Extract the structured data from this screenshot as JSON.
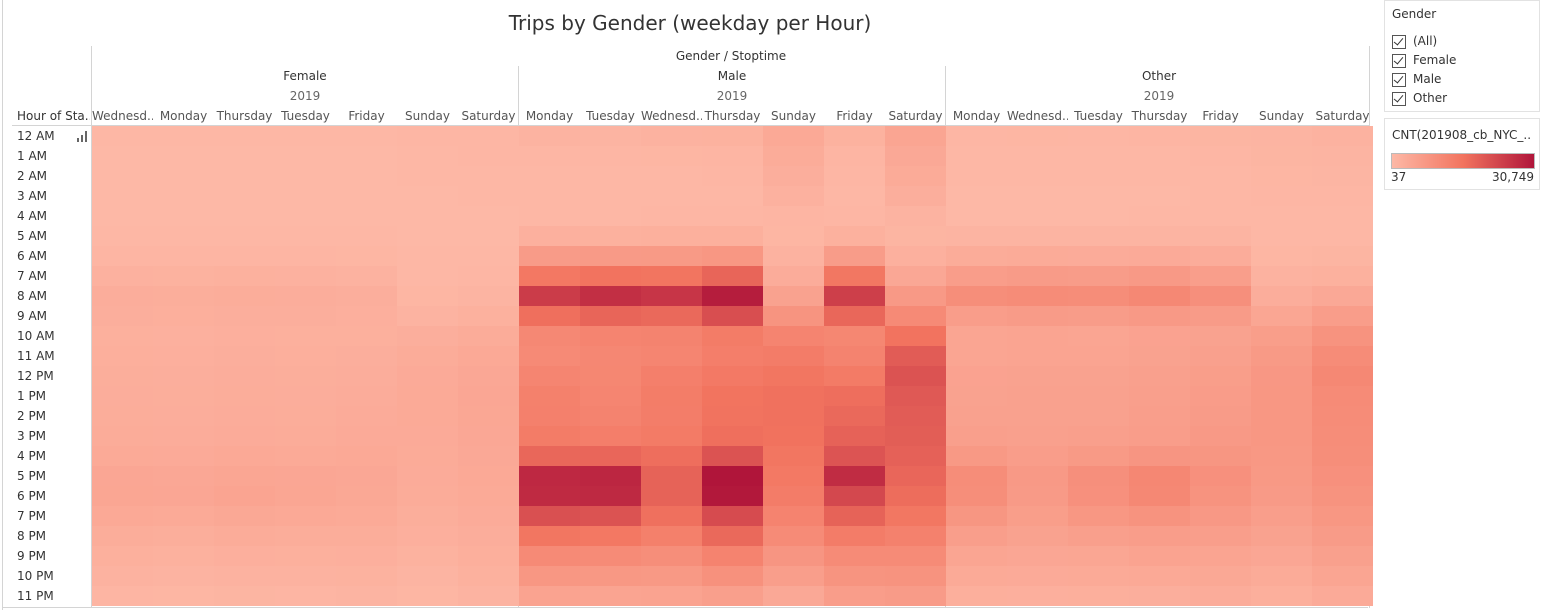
{
  "title": "Trips by Gender (weekday per Hour)",
  "header_label": "Gender / Stoptime",
  "row_axis_title": "Hour of Sta..",
  "filter": {
    "title": "Gender",
    "options": [
      {
        "label": "(All)",
        "checked": true
      },
      {
        "label": "Female",
        "checked": true
      },
      {
        "label": "Male",
        "checked": true
      },
      {
        "label": "Other",
        "checked": true
      }
    ]
  },
  "legend": {
    "title": "CNT(201908_cb_NYC_...",
    "min_label": "37",
    "max_label": "30,749",
    "color_low": "#fdb8a6",
    "color_mid": "#f2745f",
    "color_high": "#b0153a"
  },
  "chart_data": {
    "type": "heatmap",
    "title": "Trips by Gender (weekday per Hour)",
    "xlabel": "Gender / Stoptime",
    "ylabel": "Hour of Sta..",
    "color_range": [
      37,
      30749
    ],
    "hours": [
      "12 AM",
      "1 AM",
      "2 AM",
      "3 AM",
      "4 AM",
      "5 AM",
      "6 AM",
      "7 AM",
      "8 AM",
      "9 AM",
      "10 AM",
      "11 AM",
      "12 PM",
      "1 PM",
      "2 PM",
      "3 PM",
      "4 PM",
      "5 PM",
      "6 PM",
      "7 PM",
      "8 PM",
      "9 PM",
      "10 PM",
      "11 PM"
    ],
    "groups": [
      {
        "gender": "Female",
        "year": "2019",
        "days": [
          "Wednesd..",
          "Monday",
          "Thursday",
          "Tuesday",
          "Friday",
          "Sunday",
          "Saturday"
        ],
        "values": [
          [
            200,
            160,
            220,
            150,
            250,
            400,
            500
          ],
          [
            100,
            80,
            110,
            70,
            120,
            300,
            380
          ],
          [
            60,
            50,
            70,
            45,
            70,
            200,
            260
          ],
          [
            40,
            37,
            45,
            37,
            45,
            130,
            170
          ],
          [
            50,
            45,
            55,
            45,
            55,
            80,
            100
          ],
          [
            200,
            180,
            210,
            190,
            200,
            80,
            100
          ],
          [
            700,
            650,
            720,
            680,
            600,
            150,
            180
          ],
          [
            1600,
            1500,
            1700,
            1600,
            1400,
            300,
            400
          ],
          [
            2500,
            2400,
            2600,
            2500,
            2200,
            600,
            900
          ],
          [
            2200,
            2100,
            2300,
            2200,
            2000,
            1200,
            1700
          ],
          [
            1900,
            1800,
            2000,
            1900,
            1900,
            2300,
            2800
          ],
          [
            2100,
            2000,
            2200,
            2100,
            2200,
            2800,
            3500
          ],
          [
            2400,
            2300,
            2500,
            2400,
            2500,
            3100,
            3800
          ],
          [
            2500,
            2400,
            2600,
            2500,
            2700,
            3300,
            4000
          ],
          [
            2600,
            2500,
            2700,
            2600,
            2900,
            3200,
            3900
          ],
          [
            2800,
            2700,
            2900,
            2800,
            3100,
            3100,
            3800
          ],
          [
            3200,
            3100,
            3400,
            3300,
            3400,
            3000,
            3600
          ],
          [
            4000,
            3800,
            4200,
            4000,
            3800,
            2900,
            3400
          ],
          [
            4200,
            4000,
            4500,
            4200,
            3700,
            2800,
            3300
          ],
          [
            3500,
            3300,
            3700,
            3500,
            3200,
            2400,
            2900
          ],
          [
            2600,
            2400,
            2800,
            2600,
            2600,
            2000,
            2500
          ],
          [
            1900,
            1700,
            2000,
            1900,
            2000,
            1500,
            2100
          ],
          [
            1300,
            1100,
            1400,
            1300,
            1500,
            1000,
            1700
          ],
          [
            700,
            600,
            800,
            700,
            1000,
            600,
            1200
          ]
        ]
      },
      {
        "gender": "Male",
        "year": "2019",
        "days": [
          "Monday",
          "Tuesday",
          "Wednesd..",
          "Thursday",
          "Sunday",
          "Friday",
          "Saturday"
        ],
        "values": [
          [
            1200,
            1000,
            1300,
            1500,
            3400,
            1500,
            4400
          ],
          [
            500,
            400,
            600,
            700,
            2800,
            700,
            3600
          ],
          [
            300,
            250,
            350,
            400,
            2300,
            450,
            3000
          ],
          [
            200,
            180,
            250,
            280,
            1600,
            300,
            2200
          ],
          [
            350,
            300,
            380,
            400,
            700,
            380,
            1100
          ],
          [
            1800,
            1700,
            1900,
            1900,
            600,
            1700,
            800
          ],
          [
            6500,
            6800,
            6900,
            7600,
            1300,
            6400,
            1800
          ],
          [
            14500,
            15500,
            15200,
            17800,
            2700,
            14800,
            3800
          ],
          [
            24500,
            26500,
            25500,
            29500,
            5000,
            24000,
            7000
          ],
          [
            16200,
            17800,
            17200,
            21500,
            8200,
            17500,
            10500
          ],
          [
            10800,
            11800,
            12000,
            13600,
            11800,
            11200,
            15500
          ],
          [
            10500,
            11000,
            11600,
            13100,
            13500,
            12000,
            19300
          ],
          [
            11500,
            11200,
            12800,
            14200,
            14900,
            13800,
            20800
          ],
          [
            12500,
            11600,
            13400,
            15300,
            15800,
            16300,
            19700
          ],
          [
            12600,
            12000,
            13300,
            15600,
            15800,
            17200,
            19300
          ],
          [
            13600,
            13100,
            13900,
            16200,
            15700,
            18300,
            19000
          ],
          [
            17500,
            17600,
            16300,
            20700,
            15000,
            20500,
            18500
          ],
          [
            27600,
            28000,
            18200,
            30749,
            14300,
            27000,
            17600
          ],
          [
            27300,
            27500,
            18200,
            30200,
            13500,
            22500,
            16500
          ],
          [
            21200,
            20800,
            16000,
            22000,
            11900,
            18200,
            14700
          ],
          [
            14900,
            14500,
            12700,
            17200,
            10100,
            13500,
            12400
          ],
          [
            10500,
            10200,
            9600,
            11900,
            7900,
            10100,
            10300
          ],
          [
            7600,
            7300,
            7100,
            8800,
            5900,
            8200,
            8500
          ],
          [
            4800,
            4600,
            4700,
            5600,
            3600,
            6100,
            6500
          ]
        ]
      },
      {
        "gender": "Other",
        "year": "2019",
        "days": [
          "Monday",
          "Wednesd..",
          "Tuesday",
          "Thursday",
          "Friday",
          "Sunday",
          "Saturday"
        ],
        "values": [
          [
            500,
            600,
            550,
            700,
            800,
            1000,
            1300
          ],
          [
            250,
            300,
            280,
            350,
            400,
            800,
            1000
          ],
          [
            150,
            180,
            160,
            200,
            250,
            600,
            750
          ],
          [
            100,
            120,
            110,
            130,
            160,
            400,
            500
          ],
          [
            120,
            140,
            130,
            150,
            170,
            200,
            250
          ],
          [
            900,
            950,
            920,
            1000,
            900,
            250,
            300
          ],
          [
            2800,
            3000,
            2900,
            3100,
            2700,
            600,
            800
          ],
          [
            6200,
            6600,
            6400,
            7000,
            5800,
            1300,
            1700
          ],
          [
            9500,
            10000,
            9800,
            10800,
            9200,
            2500,
            3600
          ],
          [
            6200,
            6600,
            6400,
            7000,
            6600,
            4200,
            6200
          ],
          [
            4300,
            4600,
            4400,
            4900,
            5000,
            6000,
            8500
          ],
          [
            4400,
            4600,
            4500,
            5000,
            5400,
            6900,
            10000
          ],
          [
            4900,
            5000,
            5000,
            5500,
            6000,
            7400,
            10800
          ],
          [
            5100,
            5200,
            5200,
            5700,
            6300,
            7600,
            10300
          ],
          [
            5200,
            5200,
            5200,
            5800,
            6600,
            7600,
            10000
          ],
          [
            5600,
            5500,
            5600,
            6200,
            7000,
            7500,
            9800
          ],
          [
            7100,
            6200,
            6900,
            7900,
            7800,
            7300,
            9500
          ],
          [
            9800,
            7000,
            9200,
            11000,
            9000,
            7100,
            9000
          ],
          [
            9500,
            6800,
            9000,
            10800,
            8500,
            6700,
            8500
          ],
          [
            7800,
            6000,
            7500,
            8500,
            7200,
            5900,
            7600
          ],
          [
            5800,
            5000,
            5600,
            6200,
            5800,
            5000,
            6500
          ],
          [
            4300,
            4000,
            4200,
            4700,
            4600,
            4000,
            5400
          ],
          [
            3200,
            3100,
            3200,
            3500,
            3700,
            3000,
            4300
          ],
          [
            2100,
            2000,
            2100,
            2300,
            2700,
            2100,
            3100
          ]
        ]
      }
    ]
  }
}
